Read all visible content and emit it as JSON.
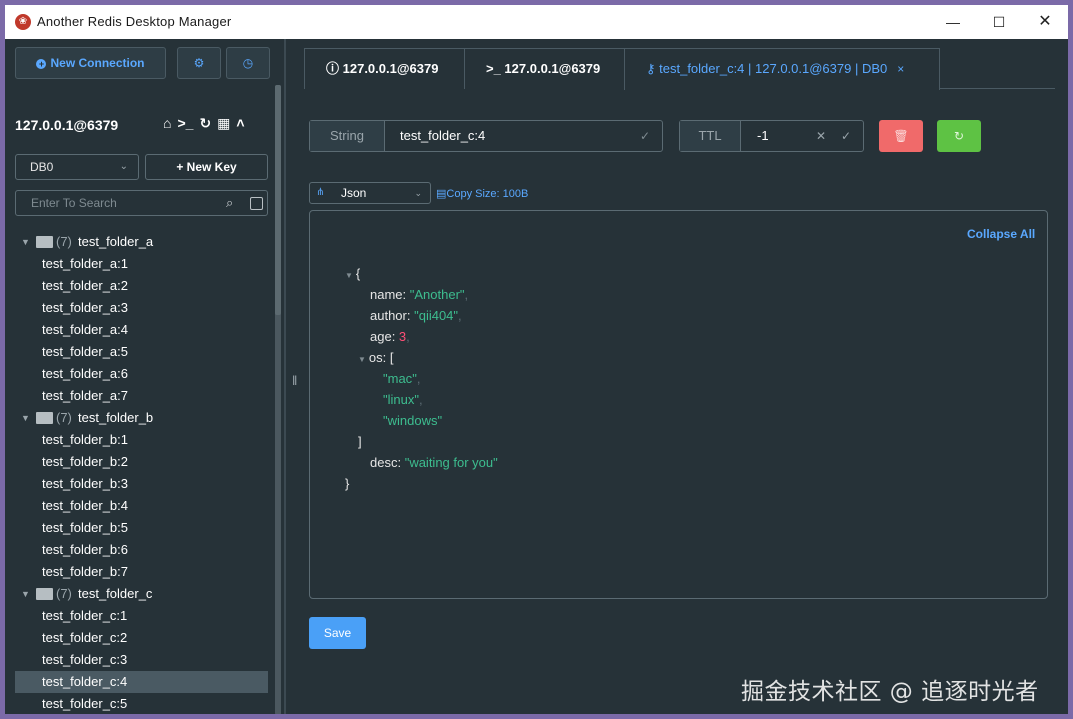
{
  "window": {
    "title": "Another Redis Desktop Manager",
    "min_icon": "—",
    "max_icon": "☐",
    "close_icon": "✕"
  },
  "sidebar": {
    "new_connection_label": "New Connection",
    "connection_name": "127.0.0.1@6379",
    "db_select": "DB0",
    "new_key_label": "+ New Key",
    "search_placeholder": "Enter To Search",
    "folders": [
      {
        "count": "(7)",
        "name": "test_folder_a",
        "keys": [
          "test_folder_a:1",
          "test_folder_a:2",
          "test_folder_a:3",
          "test_folder_a:4",
          "test_folder_a:5",
          "test_folder_a:6",
          "test_folder_a:7"
        ]
      },
      {
        "count": "(7)",
        "name": "test_folder_b",
        "keys": [
          "test_folder_b:1",
          "test_folder_b:2",
          "test_folder_b:3",
          "test_folder_b:4",
          "test_folder_b:5",
          "test_folder_b:6",
          "test_folder_b:7"
        ]
      },
      {
        "count": "(7)",
        "name": "test_folder_c",
        "keys": [
          "test_folder_c:1",
          "test_folder_c:2",
          "test_folder_c:3",
          "test_folder_c:4",
          "test_folder_c:5"
        ]
      }
    ],
    "selected_key": "test_folder_c:4"
  },
  "tabs": [
    {
      "label": "127.0.0.1@6379",
      "icon": "info-icon"
    },
    {
      "label": ">_ 127.0.0.1@6379",
      "icon": "terminal-icon"
    },
    {
      "label": "test_folder_c:4 | 127.0.0.1@6379 | DB0",
      "icon": "key-icon",
      "active": true
    }
  ],
  "key_detail": {
    "type_label": "String",
    "key_name": "test_folder_c:4",
    "ttl_label": "TTL",
    "ttl_value": "-1",
    "format": "Json",
    "copy_size": "Copy Size: 100B",
    "collapse_all": "Collapse All",
    "save_label": "Save"
  },
  "json_value": {
    "name": "Another",
    "author": "qii404",
    "age": "3",
    "os": [
      "mac",
      "linux",
      "windows"
    ],
    "desc": "waiting for you"
  },
  "watermark": "掘金技术社区 @ 追逐时光者",
  "colors": {
    "background": "#263238",
    "accent_blue": "#5aa8ff",
    "delete_red": "#f06a6a",
    "refresh_green": "#5ec244",
    "save_blue": "#4aa0f7",
    "json_string": "#3dbd8f",
    "json_number": "#ff4f76"
  }
}
